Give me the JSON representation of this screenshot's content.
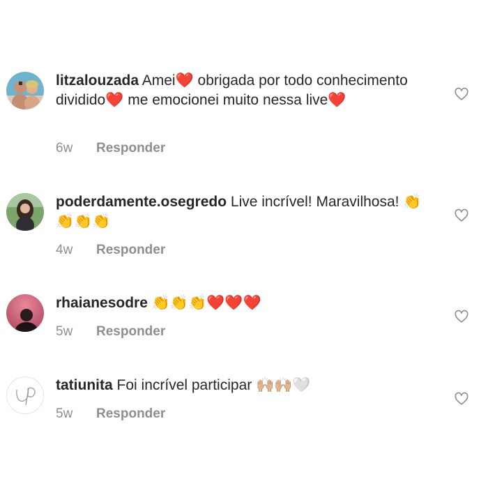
{
  "comments": [
    {
      "username": "litzalouzada",
      "text": "Amei❤️ obrigada por todo conhecimento dividido❤️ me emocionei muito nessa live❤️",
      "time": "6w",
      "reply_label": "Responder",
      "avatar_icon": "profile-photo-two-people",
      "like_icon": "heart-outline-icon"
    },
    {
      "username": "poderdamente.osegredo",
      "text": "Live incrível! Maravilhosa! 👏👏👏👏",
      "time": "4w",
      "reply_label": "Responder",
      "avatar_icon": "profile-photo-person",
      "like_icon": "heart-outline-icon"
    },
    {
      "username": "rhaianesodre",
      "text": "👏👏👏❤️❤️❤️",
      "time": "5w",
      "reply_label": "Responder",
      "avatar_icon": "profile-photo-person-dark",
      "like_icon": "heart-outline-icon"
    },
    {
      "username": "tatiunita",
      "text": "Foi incrível participar 🙌🏼🙌🏼🤍",
      "time": "5w",
      "reply_label": "Responder",
      "avatar_icon": "logo-up",
      "like_icon": "heart-outline-icon"
    }
  ],
  "colors": {
    "text": "#262626",
    "meta": "#8e8e8e",
    "heart_outline": "#8e8e8e"
  }
}
